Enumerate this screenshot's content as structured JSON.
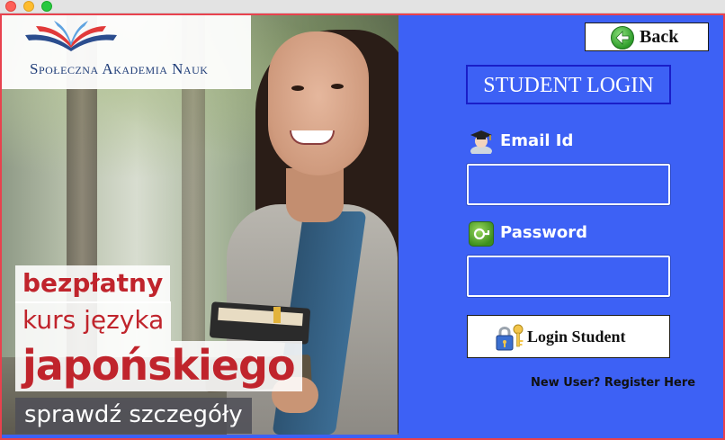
{
  "window": {
    "title_controls": [
      "close",
      "minimize",
      "zoom"
    ]
  },
  "ad": {
    "logo_text": "Społeczna Akademia Nauk",
    "line1": "bezpłatny",
    "line2": "kurs języka",
    "line3": "japońskiego",
    "line4": "sprawdź szczegóły"
  },
  "login": {
    "back_label": "Back",
    "title": "STUDENT LOGIN",
    "email_label": "Email Id",
    "email_value": "",
    "password_label": "Password",
    "password_value": "",
    "login_button_label": "Login Student",
    "register_link": "New User? Register Here"
  },
  "icons": {
    "back": "back-arrow-icon",
    "student": "student-graduate-icon",
    "password": "key-icon",
    "login": "lock-key-icon"
  },
  "colors": {
    "panel_background": "#3d61f5",
    "window_border": "#e8424e",
    "title_border": "#1a1ec8",
    "promo_red": "#c0242c"
  }
}
